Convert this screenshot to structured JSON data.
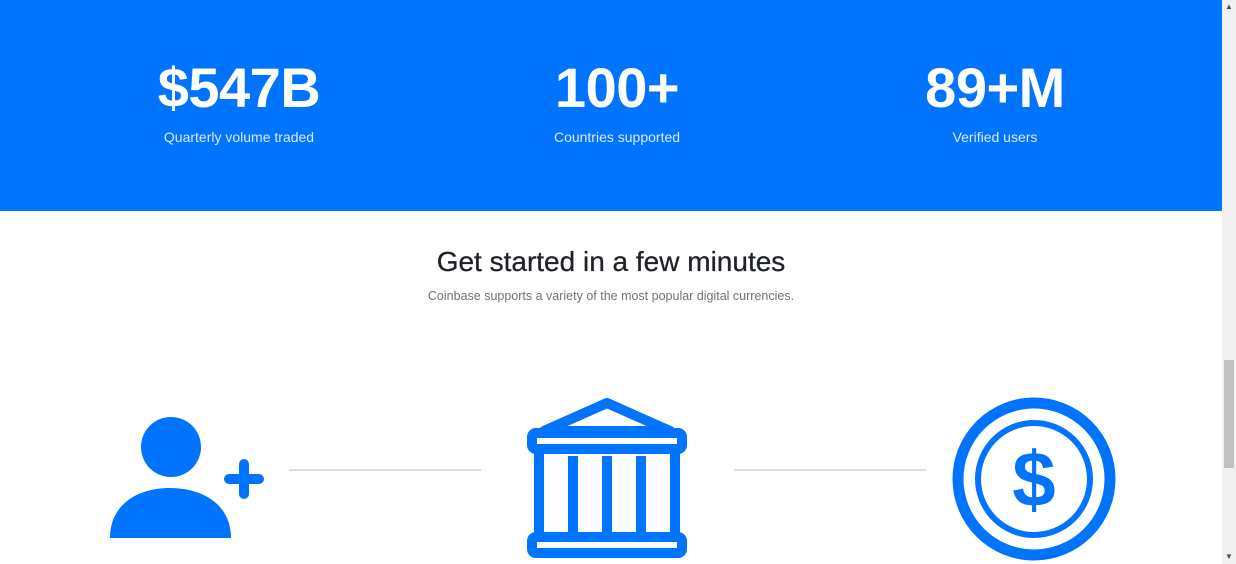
{
  "stats": [
    {
      "value": "$547B",
      "label": "Quarterly volume traded"
    },
    {
      "value": "100+",
      "label": "Countries supported"
    },
    {
      "value": "89+M",
      "label": "Verified users"
    }
  ],
  "getting_started": {
    "title": "Get started in a few minutes",
    "subtitle": "Coinbase supports a variety of the most popular digital currencies."
  },
  "steps": [
    {
      "icon": "add-user-icon"
    },
    {
      "icon": "bank-icon"
    },
    {
      "icon": "dollar-coin-icon"
    }
  ],
  "colors": {
    "brand_blue": "#0074fd",
    "connector": "#dcdcdc"
  }
}
